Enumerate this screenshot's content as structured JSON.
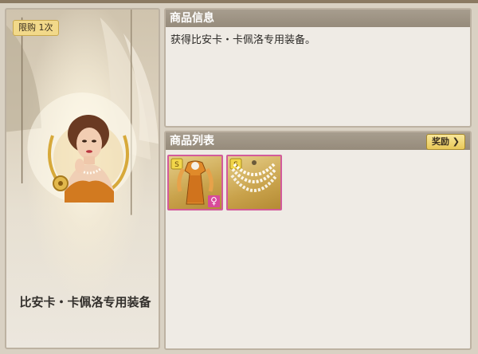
{
  "left_card": {
    "limit_label": "限购 1次",
    "item_title": "比安卡・卡佩洛专用装备"
  },
  "info_panel": {
    "header": "商品信息",
    "description": "获得比安卡・卡佩洛专用装备。"
  },
  "list_panel": {
    "header": "商品列表",
    "reward_button": "奖励 ❯",
    "items": [
      {
        "icon": "dress-icon",
        "female_symbol": "♀"
      },
      {
        "icon": "pearl-necklace-icon"
      }
    ]
  },
  "colors": {
    "panel_header": "#a0968a",
    "rarity_border": "#d25b9b",
    "badge_yellow": "#f2d98a"
  }
}
